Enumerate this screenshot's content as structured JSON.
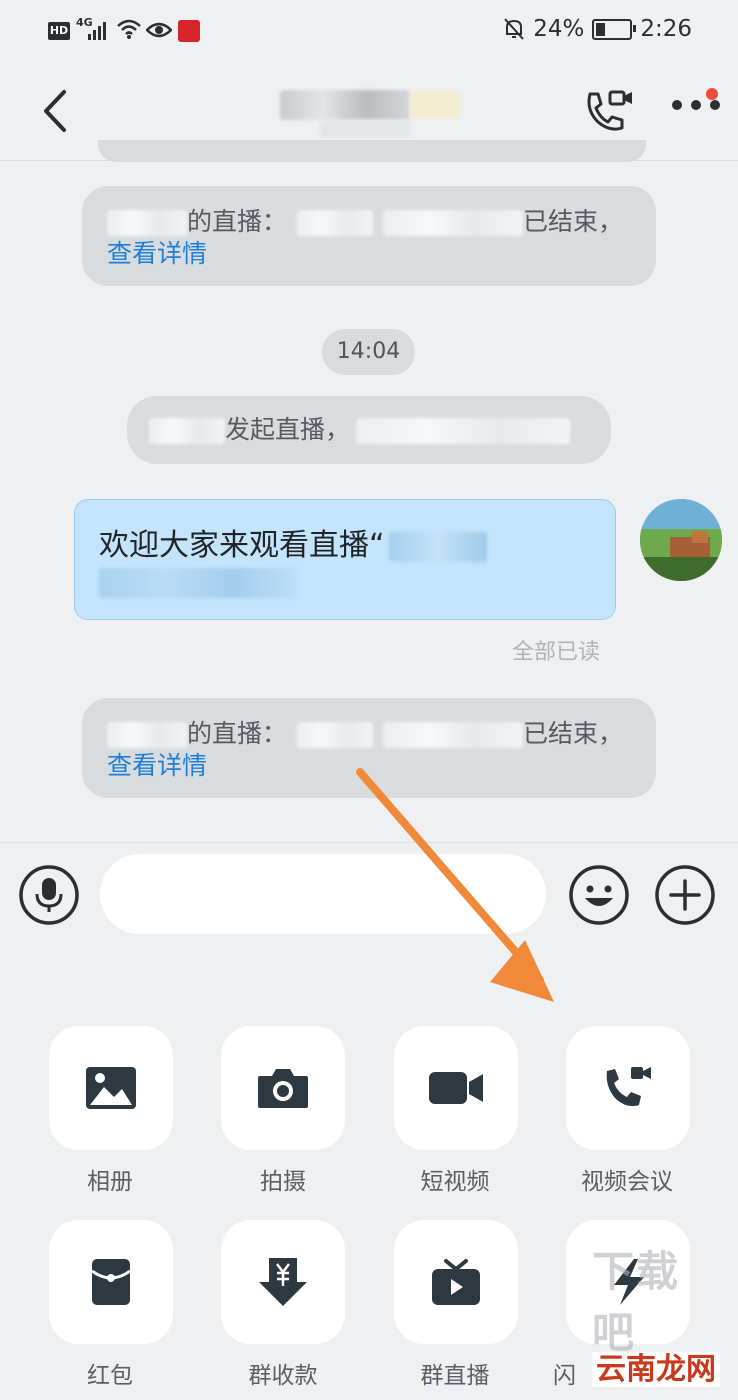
{
  "status_bar": {
    "hd": "HD",
    "network": "4G",
    "battery": "24%",
    "time": "2:26"
  },
  "nav": {
    "back_icon": "back-arrow-icon",
    "call_icon": "video-call-icon",
    "more_icon": "more-dots-icon",
    "accent_dot_color": "#f04b3c"
  },
  "messages": {
    "sys1": {
      "text": "的直播：",
      "suffix": "已结束，",
      "link": "查看详情"
    },
    "time": "14:04",
    "sys2": {
      "text": "发起直播，"
    },
    "chat": {
      "text": "欢迎大家来观看直播“",
      "read": "全部已读"
    },
    "sys3": {
      "text": "的直播：",
      "suffix": "已结束，",
      "link": "查看详情"
    }
  },
  "input": {
    "placeholder": "",
    "mic_icon": "microphone-icon",
    "emoji_icon": "emoji-icon",
    "plus_icon": "plus-icon"
  },
  "actions": [
    {
      "label": "相册",
      "icon": "album-icon"
    },
    {
      "label": "拍摄",
      "icon": "camera-icon"
    },
    {
      "label": "短视频",
      "icon": "video-icon"
    },
    {
      "label": "视频会议",
      "icon": "video-conference-icon"
    },
    {
      "label": "红包",
      "icon": "red-packet-icon"
    },
    {
      "label": "群收款",
      "icon": "group-collect-icon"
    },
    {
      "label": "群直播",
      "icon": "group-live-icon"
    },
    {
      "label": "闪",
      "icon": "lightning-icon"
    }
  ],
  "watermark": {
    "text": "云南龙网",
    "bg_text": "下载吧"
  },
  "colors": {
    "link": "#1d7fd6",
    "bubble": "#c3e4fb",
    "arrow": "#f08a3a"
  }
}
